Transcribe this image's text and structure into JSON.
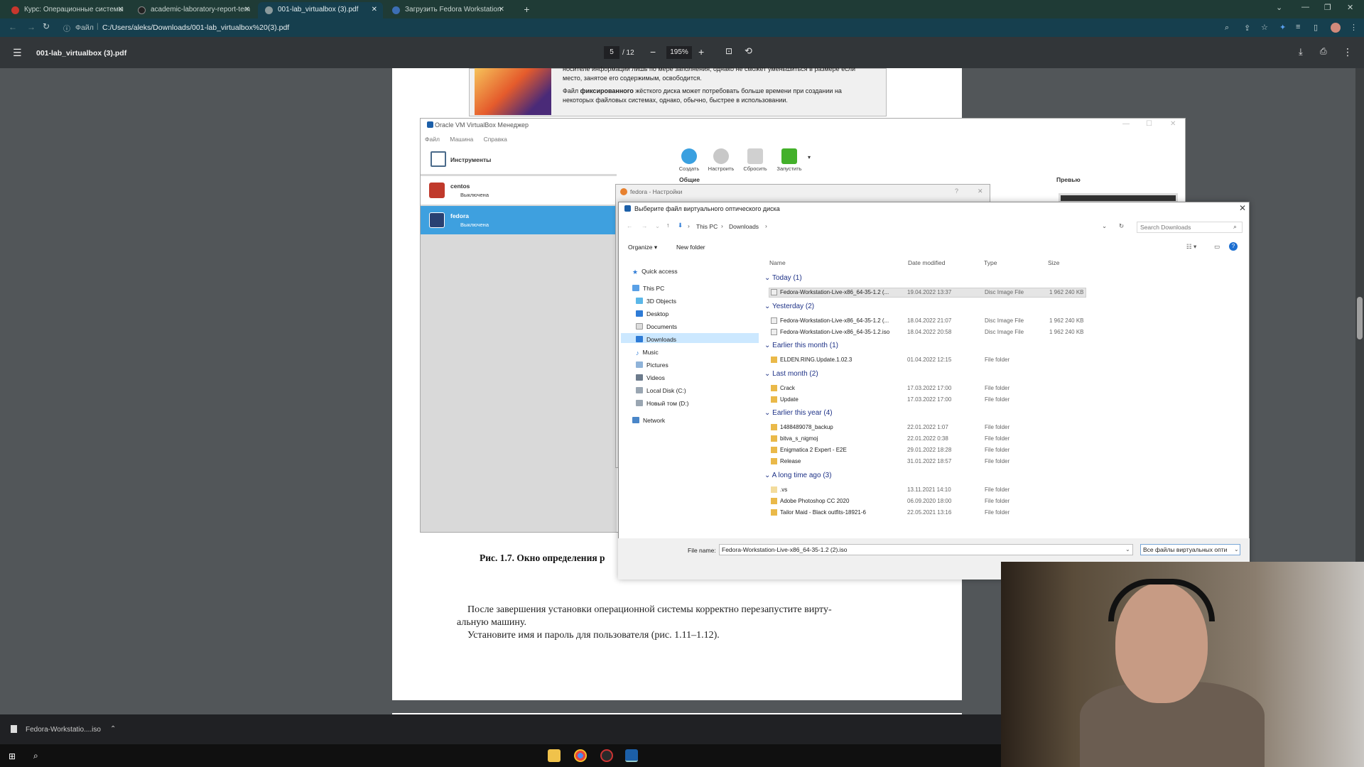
{
  "browser": {
    "tabs": [
      {
        "label": "Курс: Операционные системы",
        "color": "#c8372d"
      },
      {
        "label": "academic-laboratory-report-tem",
        "color": "#222"
      },
      {
        "label": "001-lab_virtualbox (3).pdf",
        "color": "#5f6368"
      },
      {
        "label": "Загрузить Fedora Workstation",
        "color": "#3c6eb4"
      }
    ],
    "new_tab": "+",
    "address_prefix": "Файл",
    "address": "C:/Users/aleks/Downloads/001-lab_virtualbox%20(3).pdf"
  },
  "pdf": {
    "title": "001-lab_virtualbox (3).pdf",
    "page_current": "5",
    "page_total": "/ 12",
    "zoom": "195%",
    "embedded_text_1": "носителе информации лишь по мере заполнения, однако не сможет уменьшиться в размере если место, занятое его содержимым, освободится.",
    "embedded_text_2a": "Файл ",
    "embedded_text_2b": "фиксированного",
    "embedded_text_2c": " жёсткого диска может потребовать больше времени при создании на некоторых файловых системах, однако, обычно, быстрее в использовании.",
    "caption": "Рис. 1.7. Окно определения р",
    "para1_line1": "После завершения установки операционной системы корректно перезапустите вирту-",
    "para1_line2": "альную машину.",
    "para2": "Установите имя и пароль для пользователя (рис. 1.11–1.12)."
  },
  "vbox": {
    "title": "Oracle VM VirtualBox Менеджер",
    "menu": [
      "Файл",
      "Машина",
      "Справка"
    ],
    "tools_label": "Инструменты",
    "vms": [
      {
        "name": "centos",
        "state": "Выключена"
      },
      {
        "name": "fedora",
        "state": "Выключена"
      }
    ],
    "toolbar": [
      "Создать",
      "Настроить",
      "Сбросить",
      "Запустить"
    ],
    "general_label": "Общие",
    "preview_label": "Превью",
    "settings_title": "fedora - Настройки"
  },
  "file_dialog": {
    "title": "Выберите файл виртуального оптического диска",
    "crumbs": [
      "This PC",
      "Downloads"
    ],
    "search_placeholder": "Search Downloads",
    "organize": "Organize ▾",
    "new_folder": "New folder",
    "nav": [
      {
        "label": "Quick access",
        "icon": "star-icon"
      },
      {
        "label": "This PC",
        "icon": "pc-icon"
      },
      {
        "label": "3D Objects",
        "icon": "cube-icon"
      },
      {
        "label": "Desktop",
        "icon": "desktop-icon"
      },
      {
        "label": "Documents",
        "icon": "document-icon"
      },
      {
        "label": "Downloads",
        "icon": "download-icon"
      },
      {
        "label": "Music",
        "icon": "music-icon"
      },
      {
        "label": "Pictures",
        "icon": "picture-icon"
      },
      {
        "label": "Videos",
        "icon": "video-icon"
      },
      {
        "label": "Local Disk (C:)",
        "icon": "disk-icon"
      },
      {
        "label": "Новый том (D:)",
        "icon": "disk-icon"
      },
      {
        "label": "Network",
        "icon": "network-icon"
      }
    ],
    "columns": [
      "Name",
      "Date modified",
      "Type",
      "Size"
    ],
    "groups": [
      {
        "label": "Today (1)",
        "rows": [
          {
            "name": "Fedora-Workstation-Live-x86_64-35-1.2 (...",
            "date": "19.04.2022 13:37",
            "type": "Disc Image File",
            "size": "1 962 240 KB",
            "kind": "disc"
          }
        ]
      },
      {
        "label": "Yesterday (2)",
        "rows": [
          {
            "name": "Fedora-Workstation-Live-x86_64-35-1.2 (...",
            "date": "18.04.2022 21:07",
            "type": "Disc Image File",
            "size": "1 962 240 KB",
            "kind": "disc"
          },
          {
            "name": "Fedora-Workstation-Live-x86_64-35-1.2.iso",
            "date": "18.04.2022 20:58",
            "type": "Disc Image File",
            "size": "1 962 240 KB",
            "kind": "disc"
          }
        ]
      },
      {
        "label": "Earlier this month (1)",
        "rows": [
          {
            "name": "ELDEN.RING.Update.1.02.3",
            "date": "01.04.2022 12:15",
            "type": "File folder",
            "size": "",
            "kind": "folder"
          }
        ]
      },
      {
        "label": "Last month (2)",
        "rows": [
          {
            "name": "Crack",
            "date": "17.03.2022 17:00",
            "type": "File folder",
            "size": "",
            "kind": "folder"
          },
          {
            "name": "Update",
            "date": "17.03.2022 17:00",
            "type": "File folder",
            "size": "",
            "kind": "folder"
          }
        ]
      },
      {
        "label": "Earlier this year (4)",
        "rows": [
          {
            "name": "1488489078_backup",
            "date": "22.01.2022 1:07",
            "type": "File folder",
            "size": "",
            "kind": "folder"
          },
          {
            "name": "bitva_s_nigmoj",
            "date": "22.01.2022 0:38",
            "type": "File folder",
            "size": "",
            "kind": "folder"
          },
          {
            "name": "Enigmatica 2 Expert - E2E",
            "date": "29.01.2022 18:28",
            "type": "File folder",
            "size": "",
            "kind": "folder"
          },
          {
            "name": "Release",
            "date": "31.01.2022 18:57",
            "type": "File folder",
            "size": "",
            "kind": "folder"
          }
        ]
      },
      {
        "label": "A long time ago (3)",
        "rows": [
          {
            "name": ".vs",
            "date": "13.11.2021 14:10",
            "type": "File folder",
            "size": "",
            "kind": "folder"
          },
          {
            "name": "Adobe Photoshop CC 2020",
            "date": "06.09.2020 18:00",
            "type": "File folder",
            "size": "",
            "kind": "folder"
          },
          {
            "name": "Tailor Maid - Black outfits-18921-6",
            "date": "22.05.2021 13:16",
            "type": "File folder",
            "size": "",
            "kind": "folder"
          }
        ]
      }
    ],
    "filename_label": "File name:",
    "filename_value": "Fedora-Workstation-Live-x86_64-35-1.2 (2).iso",
    "filter_value": "Все файлы виртуальных опти"
  },
  "downloads_bar": {
    "item": "Fedora-Workstatio....iso"
  }
}
